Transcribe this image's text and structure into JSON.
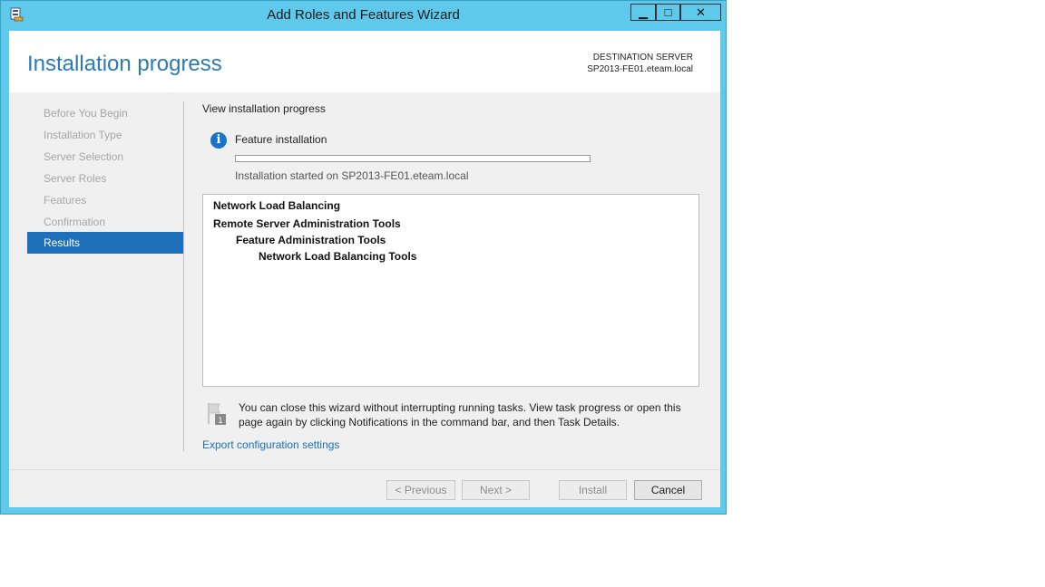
{
  "window": {
    "title": "Add Roles and Features Wizard",
    "controls": {
      "minimize": "▁",
      "maximize": "□",
      "close": "✕"
    }
  },
  "header": {
    "page_title": "Installation progress",
    "destination_label": "DESTINATION SERVER",
    "destination_server": "SP2013-FE01.eteam.local"
  },
  "nav": {
    "items": [
      {
        "label": "Before You Begin",
        "active": false
      },
      {
        "label": "Installation Type",
        "active": false
      },
      {
        "label": "Server Selection",
        "active": false
      },
      {
        "label": "Server Roles",
        "active": false
      },
      {
        "label": "Features",
        "active": false
      },
      {
        "label": "Confirmation",
        "active": false
      },
      {
        "label": "Results",
        "active": true
      }
    ]
  },
  "content": {
    "section_title": "View installation progress",
    "feature_label": "Feature installation",
    "progress_fraction": 0,
    "started_text": "Installation started on SP2013-FE01.eteam.local",
    "features": [
      {
        "label": "Network Load Balancing",
        "level": 0
      },
      {
        "label": "Remote Server Administration Tools",
        "level": 0
      },
      {
        "label": "Feature Administration Tools",
        "level": 1
      },
      {
        "label": "Network Load Balancing Tools",
        "level": 2
      }
    ],
    "note_text": "You can close this wizard without interrupting running tasks. View task progress or open this page again by clicking Notifications in the command bar, and then Task Details.",
    "flag_badge": "1",
    "export_link": "Export configuration settings"
  },
  "footer": {
    "previous": "< Previous",
    "next": "Next >",
    "install": "Install",
    "cancel": "Cancel"
  },
  "colors": {
    "frame": "#5ec9eb",
    "accent": "#1c6fb8",
    "title_blue": "#2a7ab6"
  }
}
